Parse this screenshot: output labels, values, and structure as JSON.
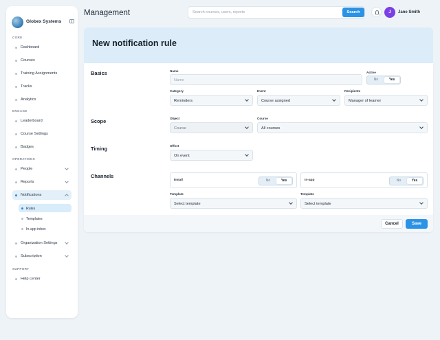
{
  "sidebar": {
    "brand": "Globex Systems",
    "sections": {
      "core": "CORE",
      "engage": "ENGAGE",
      "operations": "OPERATIONS",
      "support": "SUPPORT"
    },
    "items": {
      "dashboard": "Dashboard",
      "courses": "Courses",
      "training": "Training Assignments",
      "tracks": "Tracks",
      "analytics": "Analytics",
      "leaderboard": "Leaderboard",
      "course_settings": "Course Settings",
      "badges": "Badges",
      "people": "People",
      "reports": "Reports",
      "notifications": "Notifications",
      "rules": "Rules",
      "templates": "Templates",
      "inbox": "In-app inbox",
      "org_settings": "Organization Settings",
      "subscription": "Subscription",
      "help": "Help center"
    }
  },
  "header": {
    "title": "Management",
    "search_placeholder": "Search courses, users, reports",
    "search_button": "Search",
    "user_initial": "J",
    "user_name": "Jane Smith"
  },
  "form": {
    "title": "New notification rule",
    "basics": {
      "heading": "Basics",
      "name_label": "Name",
      "name_placeholder": "Name",
      "active_label": "Active",
      "no": "No",
      "yes": "Yes",
      "category_label": "Category",
      "category_value": "Reminders",
      "event_label": "Event",
      "event_value": "Course assigned",
      "recipients_label": "Recipients",
      "recipients_value": "Manager of learner"
    },
    "scope": {
      "heading": "Scope",
      "object_label": "Object",
      "object_value": "Course",
      "course_label": "Course",
      "course_value": "All courses"
    },
    "timing": {
      "heading": "Timing",
      "offset_label": "Offset",
      "offset_value": "On event"
    },
    "channels": {
      "heading": "Channels",
      "email_label": "Email",
      "inapp_label": "In-app",
      "no": "No",
      "yes": "Yes",
      "template_label": "Template",
      "template_placeholder": "Select template"
    },
    "cancel": "Cancel",
    "save": "Save"
  },
  "colors": {
    "accent": "#2b93e6",
    "avatar": "#7b3fe4",
    "hero": "#dcecf9"
  }
}
